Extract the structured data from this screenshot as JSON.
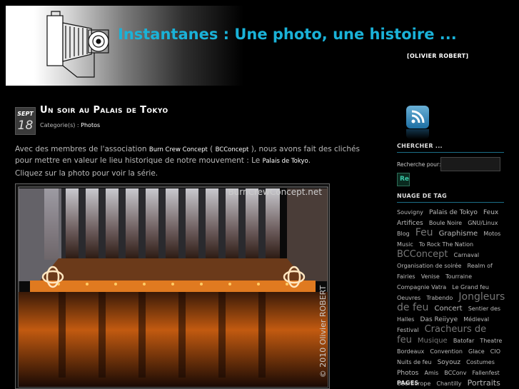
{
  "header": {
    "title": "Instantanes : Une photo, une histoire ...",
    "author": "[OLIVIER ROBERT]"
  },
  "post": {
    "date_month": "SEPT",
    "date_day": "18",
    "title": "Un soir au Palais de Tokyo",
    "category_label": "Categorie(s) : ",
    "category_value": "Photos",
    "para1_a": "Avec des membres de l'association ",
    "para1_link1": "Burn Crew Concept",
    "para1_b": " ( ",
    "para1_link2": "BCConcept",
    "para1_c": " ), nous avons fait des clichés pour mettre en valeur le lieu historique de notre mouvement : Le ",
    "para1_link3": "Palais de Tokyo",
    "para1_d": ".",
    "para2": "Cliquez sur la photo pour voir la série.",
    "photo_watermark_top": "BurnCrewConcept.net",
    "photo_watermark_side": "© 2010 Olivier ROBERT"
  },
  "sidebar": {
    "search_heading": "CHERCHER ...",
    "search_label": "Recherche pour:",
    "search_button": "Re",
    "tags_heading": "NUAGE DE TAG",
    "pages_heading": "PAGES",
    "tags": [
      {
        "label": "Souvigny",
        "size": 8,
        "color": "#bbb"
      },
      {
        "label": "Palais de Tokyo",
        "size": 9,
        "color": "#bbb"
      },
      {
        "label": "Feux Artifices",
        "size": 9,
        "color": "#bbb"
      },
      {
        "label": "Boule Noire",
        "size": 8,
        "color": "#bbb"
      },
      {
        "label": "GNU/Linux",
        "size": 8,
        "color": "#bbb"
      },
      {
        "label": "Blog",
        "size": 8,
        "color": "#bbb"
      },
      {
        "label": "Feu",
        "size": 14,
        "color": "#777"
      },
      {
        "label": "Graphisme",
        "size": 10,
        "color": "#bbb"
      },
      {
        "label": "Motos",
        "size": 8,
        "color": "#bbb"
      },
      {
        "label": "Music",
        "size": 8,
        "color": "#bbb"
      },
      {
        "label": "To Rock The Nation",
        "size": 8,
        "color": "#bbb"
      },
      {
        "label": "BCConcept",
        "size": 13,
        "color": "#777"
      },
      {
        "label": "Carnaval",
        "size": 8,
        "color": "#bbb"
      },
      {
        "label": "Organisation de soirée",
        "size": 8,
        "color": "#bbb"
      },
      {
        "label": "Realm of Fairies",
        "size": 8,
        "color": "#bbb"
      },
      {
        "label": "Venise",
        "size": 8,
        "color": "#bbb"
      },
      {
        "label": "Tourraine",
        "size": 8,
        "color": "#bbb"
      },
      {
        "label": "Compagnie Vatra",
        "size": 8,
        "color": "#bbb"
      },
      {
        "label": "Le Grand feu",
        "size": 8,
        "color": "#bbb"
      },
      {
        "label": "Oeuvres",
        "size": 8,
        "color": "#bbb"
      },
      {
        "label": "Trabendo",
        "size": 8,
        "color": "#bbb"
      },
      {
        "label": "Jongleurs de feu",
        "size": 14,
        "color": "#777"
      },
      {
        "label": "Concert",
        "size": 10,
        "color": "#bbb"
      },
      {
        "label": "Sentier des Halles",
        "size": 8,
        "color": "#bbb"
      },
      {
        "label": "Das Reiiyye",
        "size": 9,
        "color": "#bbb"
      },
      {
        "label": "Médieval Festival",
        "size": 8,
        "color": "#bbb"
      },
      {
        "label": "Cracheurs de feu",
        "size": 13,
        "color": "#777"
      },
      {
        "label": "Musique",
        "size": 10,
        "color": "#777"
      },
      {
        "label": "Batofar",
        "size": 8,
        "color": "#bbb"
      },
      {
        "label": "Theatre",
        "size": 8,
        "color": "#bbb"
      },
      {
        "label": "Bordeaux",
        "size": 8,
        "color": "#bbb"
      },
      {
        "label": "Convention",
        "size": 8,
        "color": "#bbb"
      },
      {
        "label": "Glace",
        "size": 8,
        "color": "#bbb"
      },
      {
        "label": "CIO",
        "size": 8,
        "color": "#bbb"
      },
      {
        "label": "Nuits de feu",
        "size": 8,
        "color": "#bbb"
      },
      {
        "label": "Soyouz",
        "size": 9,
        "color": "#bbb"
      },
      {
        "label": "Costumes",
        "size": 8,
        "color": "#bbb"
      },
      {
        "label": "Photos",
        "size": 9,
        "color": "#bbb"
      },
      {
        "label": "Amis",
        "size": 8,
        "color": "#bbb"
      },
      {
        "label": "BCConv",
        "size": 8,
        "color": "#bbb"
      },
      {
        "label": "Fallenfest",
        "size": 8,
        "color": "#bbb"
      },
      {
        "label": "UberEurope",
        "size": 8,
        "color": "#bbb"
      },
      {
        "label": "Chantilly",
        "size": 8,
        "color": "#bbb"
      },
      {
        "label": "Portraits",
        "size": 11,
        "color": "#bbb"
      }
    ]
  },
  "colors": {
    "title": "#1ab2d8",
    "accent_rule": "#1c6f87",
    "background": "#000000"
  }
}
